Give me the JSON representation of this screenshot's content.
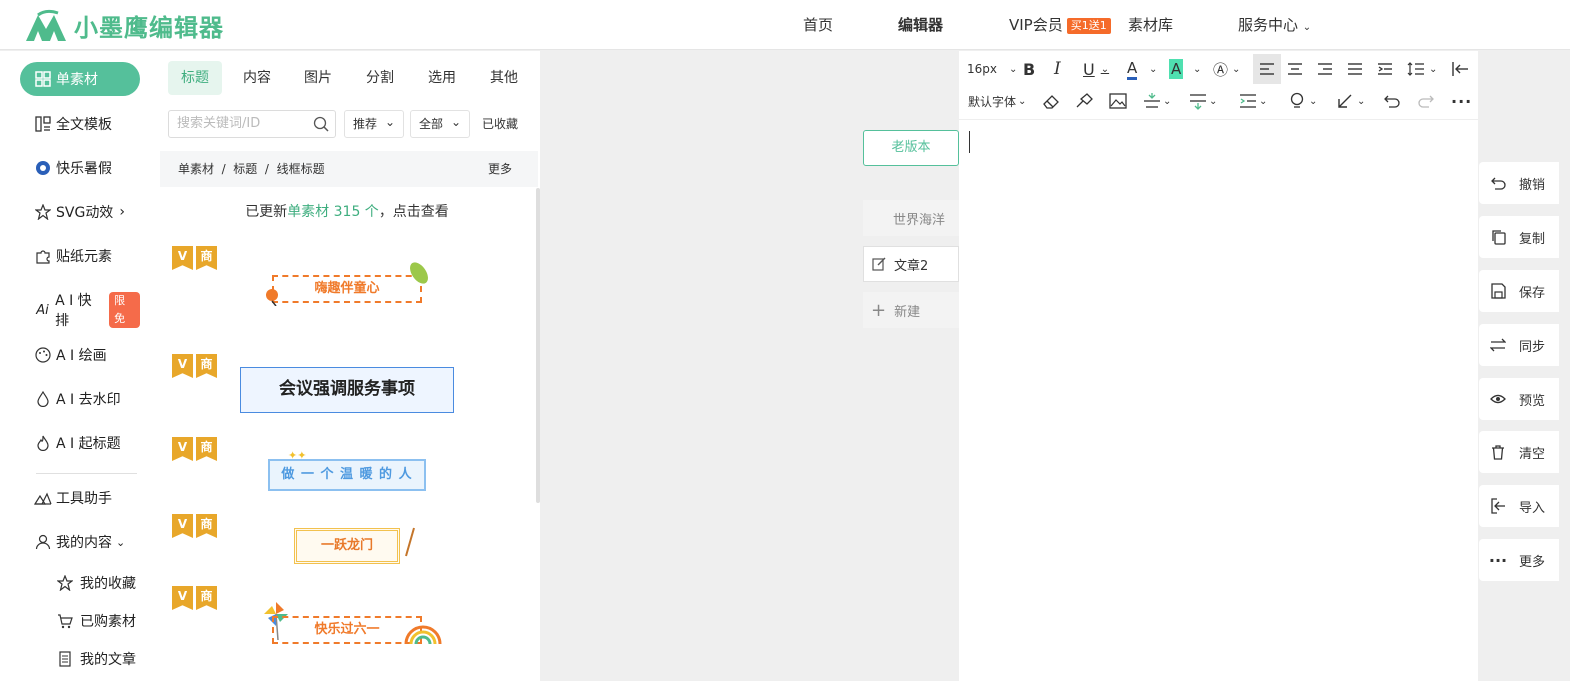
{
  "logo": {
    "text": "小墨鹰编辑器"
  },
  "nav": {
    "home": "首页",
    "editor": "编辑器",
    "vip": "VIP会员",
    "vip_badge": "买1送1",
    "library": "素材库",
    "service": "服务中心"
  },
  "sidebar": {
    "items": [
      {
        "label": "单素材",
        "icon": "grid-icon"
      },
      {
        "label": "全文模板",
        "icon": "template-icon"
      },
      {
        "label": "快乐暑假",
        "icon": "ball-icon"
      },
      {
        "label": "SVG动效",
        "icon": "star-icon"
      },
      {
        "label": "贴纸元素",
        "icon": "puzzle-icon"
      },
      {
        "label": "A I 快排",
        "icon": "ai-icon",
        "tag": "限免"
      },
      {
        "label": "A I 绘画",
        "icon": "palette-icon"
      },
      {
        "label": "A I 去水印",
        "icon": "drop-icon"
      },
      {
        "label": "A I 起标题",
        "icon": "flame-icon"
      },
      {
        "label": "工具助手",
        "icon": "tool-icon"
      },
      {
        "label": "我的内容",
        "icon": "user-icon"
      }
    ],
    "sub": [
      {
        "label": "我的收藏",
        "icon": "star-icon"
      },
      {
        "label": "已购素材",
        "icon": "cart-icon"
      },
      {
        "label": "我的文章",
        "icon": "doc-icon"
      }
    ]
  },
  "panel": {
    "tabs": [
      "标题",
      "内容",
      "图片",
      "分割",
      "选用",
      "其他"
    ],
    "search_placeholder": "搜索关键词/ID",
    "filter_sort": "推荐",
    "filter_all": "全部",
    "collected": "已收藏",
    "breadcrumb": "单素材  /  标题  /  线框标题",
    "more": "更多",
    "update_prefix": "已更新",
    "update_highlight": "单素材 315 个",
    "update_suffix": "，点击查看",
    "badge_v": "V",
    "badge_s": "商",
    "cards": [
      "嗨趣伴童心",
      "会议强调服务事项",
      "做 一 个 温 暖 的 人",
      "一跃龙门",
      "快乐过六一"
    ]
  },
  "docs": {
    "old_version": "老版本",
    "world_ocean": "世界海洋",
    "article": "文章2",
    "new": "新建"
  },
  "toolbar": {
    "font_size": "16px",
    "font_family": "默认字体"
  },
  "right_actions": [
    "撤销",
    "复制",
    "保存",
    "同步",
    "预览",
    "清空",
    "导入",
    "更多"
  ],
  "colors": {
    "accent": "#55c09b",
    "badge": "#e8a72a",
    "orange": "#f56b2a"
  }
}
